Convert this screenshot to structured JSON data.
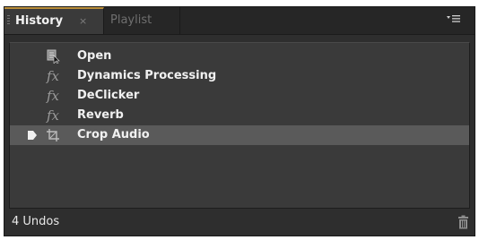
{
  "tabs": {
    "history_label": "History",
    "history_close": "×",
    "playlist_label": "Playlist",
    "menu_icon": "panel-menu-icon"
  },
  "history": {
    "items": [
      {
        "label": "Open",
        "icon": "open-document-icon",
        "selected": false
      },
      {
        "label": "Dynamics Processing",
        "icon": "fx-icon",
        "icon_text": "fx",
        "selected": false
      },
      {
        "label": "DeClicker",
        "icon": "fx-icon",
        "icon_text": "fx",
        "selected": false
      },
      {
        "label": "Reverb",
        "icon": "fx-icon",
        "icon_text": "fx",
        "selected": false
      },
      {
        "label": "Crop Audio",
        "icon": "crop-icon",
        "selected": true
      }
    ]
  },
  "footer": {
    "undo_count": "4 Undos",
    "delete_icon": "trash-icon"
  },
  "colors": {
    "accent_tab_border": "#b98e3a",
    "panel_bg": "#2e2e2e",
    "list_bg": "#3a3a3a",
    "selected_row": "#5a5a5a"
  }
}
